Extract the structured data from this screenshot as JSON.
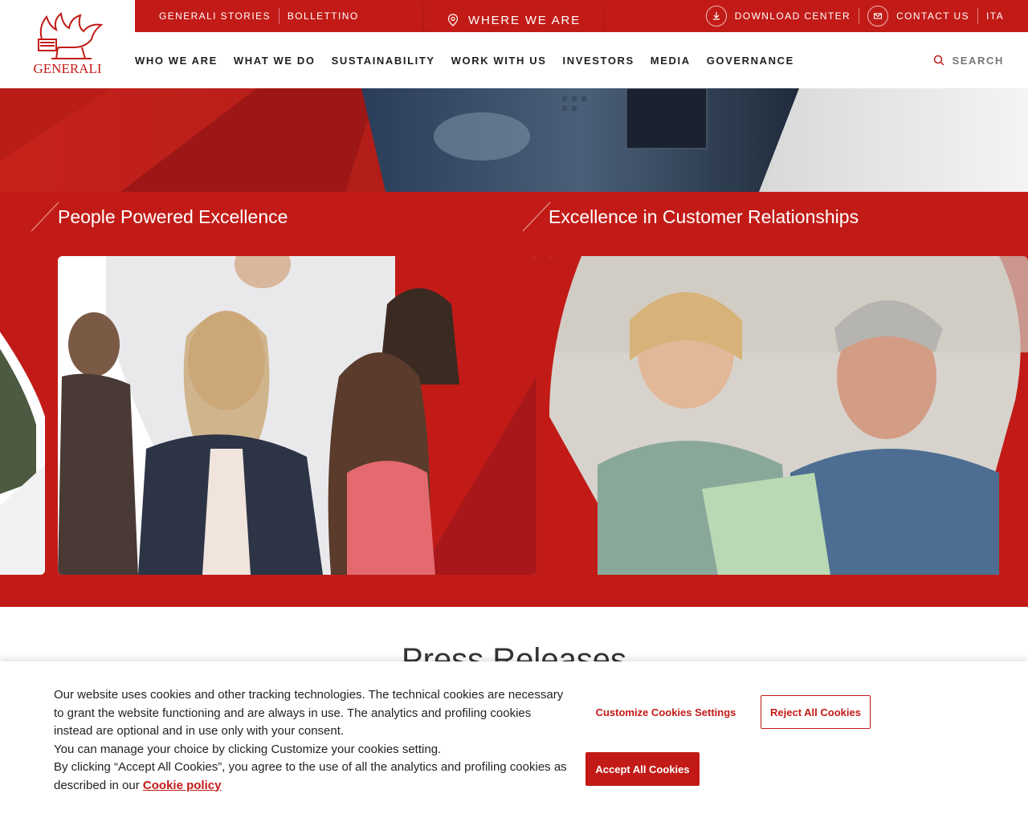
{
  "brand": {
    "logo_text": "GENERALI",
    "accent": "#c21b17"
  },
  "top_bar": {
    "left_links": [
      "GENERALI STORIES",
      "BOLLETTINO"
    ],
    "download_center": "DOWNLOAD CENTER",
    "contact_us": "CONTACT US",
    "language": "ITA"
  },
  "where_we_are": "WHERE WE ARE",
  "nav": {
    "items": [
      "WHO WE ARE",
      "WHAT WE DO",
      "SUSTAINABILITY",
      "WORK WITH US",
      "INVESTORS",
      "MEDIA",
      "GOVERNANCE"
    ],
    "search_label": "SEARCH"
  },
  "cards": [
    {
      "title": "People Powered Excellence"
    },
    {
      "title": "Excellence in Customer Relationships"
    }
  ],
  "press": {
    "title": "Press Releases"
  },
  "cookie": {
    "line1": "Our website uses cookies and other tracking technologies. The technical cookies are necessary to grant the website functioning and are always in use. The analytics and profiling cookies instead are optional and in use only with your consent.",
    "line2": "You can manage your choice by clicking Customize your cookies setting.",
    "line3": "By clicking “Accept All Cookies”, you agree to the use of all the analytics and profiling cookies as described in our",
    "policy_link": "Cookie policy",
    "customize": "Customize Cookies Settings",
    "reject": "Reject All Cookies",
    "accept": "Accept All Cookies"
  }
}
